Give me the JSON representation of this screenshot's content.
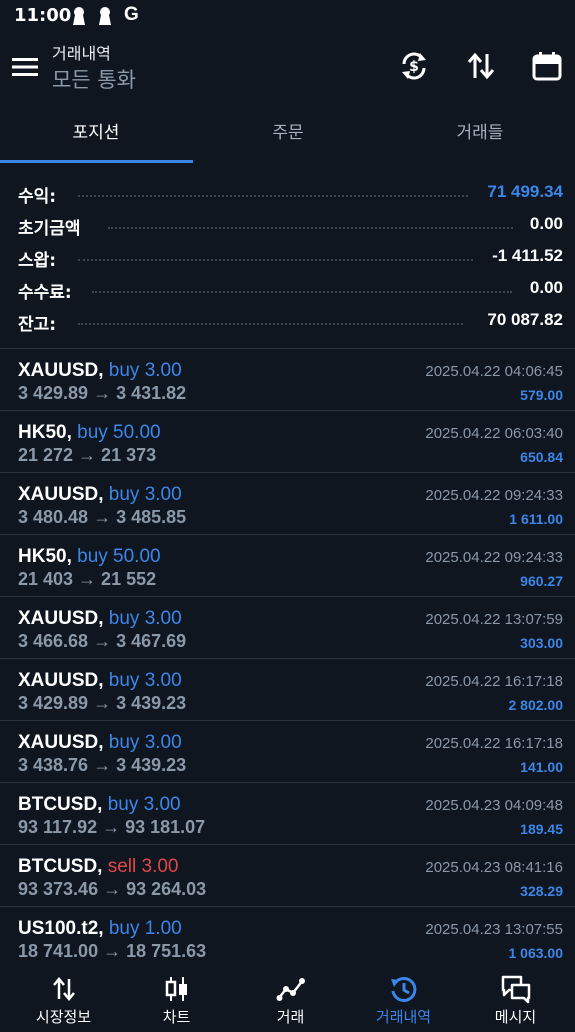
{
  "status_bar": {
    "time": "11:00",
    "g_label": "G"
  },
  "app_bar": {
    "subtitle": "거래내역",
    "title": "모든 통화",
    "icons": [
      "menu-icon",
      "currency-exchange-icon",
      "sort-arrows-icon",
      "calendar-icon"
    ]
  },
  "tabs": [
    {
      "label": "포지션",
      "active": true
    },
    {
      "label": "주문",
      "active": false
    },
    {
      "label": "거래들",
      "active": false
    }
  ],
  "summary": [
    {
      "label": "수익:",
      "value": "71 499.34",
      "color": "#3b86e8"
    },
    {
      "label": "초기금액",
      "value": "0.00",
      "color": "#ffffff"
    },
    {
      "label": "스왑:",
      "value": "-1 411.52",
      "color": "#ffffff"
    },
    {
      "label": "수수료:",
      "value": "0.00",
      "color": "#ffffff"
    },
    {
      "label": "잔고:",
      "value": "70 087.82",
      "color": "#ffffff"
    }
  ],
  "trades": [
    {
      "symbol": "XAUUSD,",
      "side": "buy 3.00",
      "side_type": "buy",
      "prices": "3 429.89 → 3 431.82",
      "time": "2025.04.22 04:06:45",
      "profit": "579.00"
    },
    {
      "symbol": "HK50,",
      "side": "buy 50.00",
      "side_type": "buy",
      "prices": "21 272 → 21 373",
      "time": "2025.04.22 06:03:40",
      "profit": "650.84"
    },
    {
      "symbol": "XAUUSD,",
      "side": "buy 3.00",
      "side_type": "buy",
      "prices": "3 480.48 → 3 485.85",
      "time": "2025.04.22 09:24:33",
      "profit": "1 611.00"
    },
    {
      "symbol": "HK50,",
      "side": "buy 50.00",
      "side_type": "buy",
      "prices": "21 403 → 21 552",
      "time": "2025.04.22 09:24:33",
      "profit": "960.27"
    },
    {
      "symbol": "XAUUSD,",
      "side": "buy 3.00",
      "side_type": "buy",
      "prices": "3 466.68 → 3 467.69",
      "time": "2025.04.22 13:07:59",
      "profit": "303.00"
    },
    {
      "symbol": "XAUUSD,",
      "side": "buy 3.00",
      "side_type": "buy",
      "prices": "3 429.89 → 3 439.23",
      "time": "2025.04.22 16:17:18",
      "profit": "2 802.00"
    },
    {
      "symbol": "XAUUSD,",
      "side": "buy 3.00",
      "side_type": "buy",
      "prices": "3 438.76 → 3 439.23",
      "time": "2025.04.22 16:17:18",
      "profit": "141.00"
    },
    {
      "symbol": "BTCUSD,",
      "side": "buy 3.00",
      "side_type": "buy",
      "prices": "93 117.92 → 93 181.07",
      "time": "2025.04.23 04:09:48",
      "profit": "189.45"
    },
    {
      "symbol": "BTCUSD,",
      "side": "sell 3.00",
      "side_type": "sell",
      "prices": "93 373.46 → 93 264.03",
      "time": "2025.04.23 08:41:16",
      "profit": "328.29"
    },
    {
      "symbol": "US100.t2,",
      "side": "buy 1.00",
      "side_type": "buy",
      "prices": "18 741.00 → 18 751.63",
      "time": "2025.04.23 13:07:55",
      "profit": "1 063.00"
    }
  ],
  "bottom_nav": [
    {
      "label": "시장정보",
      "icon": "quotes-arrows-icon",
      "active": false
    },
    {
      "label": "차트",
      "icon": "candlestick-icon",
      "active": false
    },
    {
      "label": "거래",
      "icon": "trade-line-icon",
      "active": false
    },
    {
      "label": "거래내역",
      "icon": "history-icon",
      "active": true
    },
    {
      "label": "메시지",
      "icon": "messages-icon",
      "active": false
    }
  ],
  "colors": {
    "accent": "#3b86e8",
    "sell": "#e04848",
    "background": "#0f1620",
    "muted": "#8a98a8"
  }
}
